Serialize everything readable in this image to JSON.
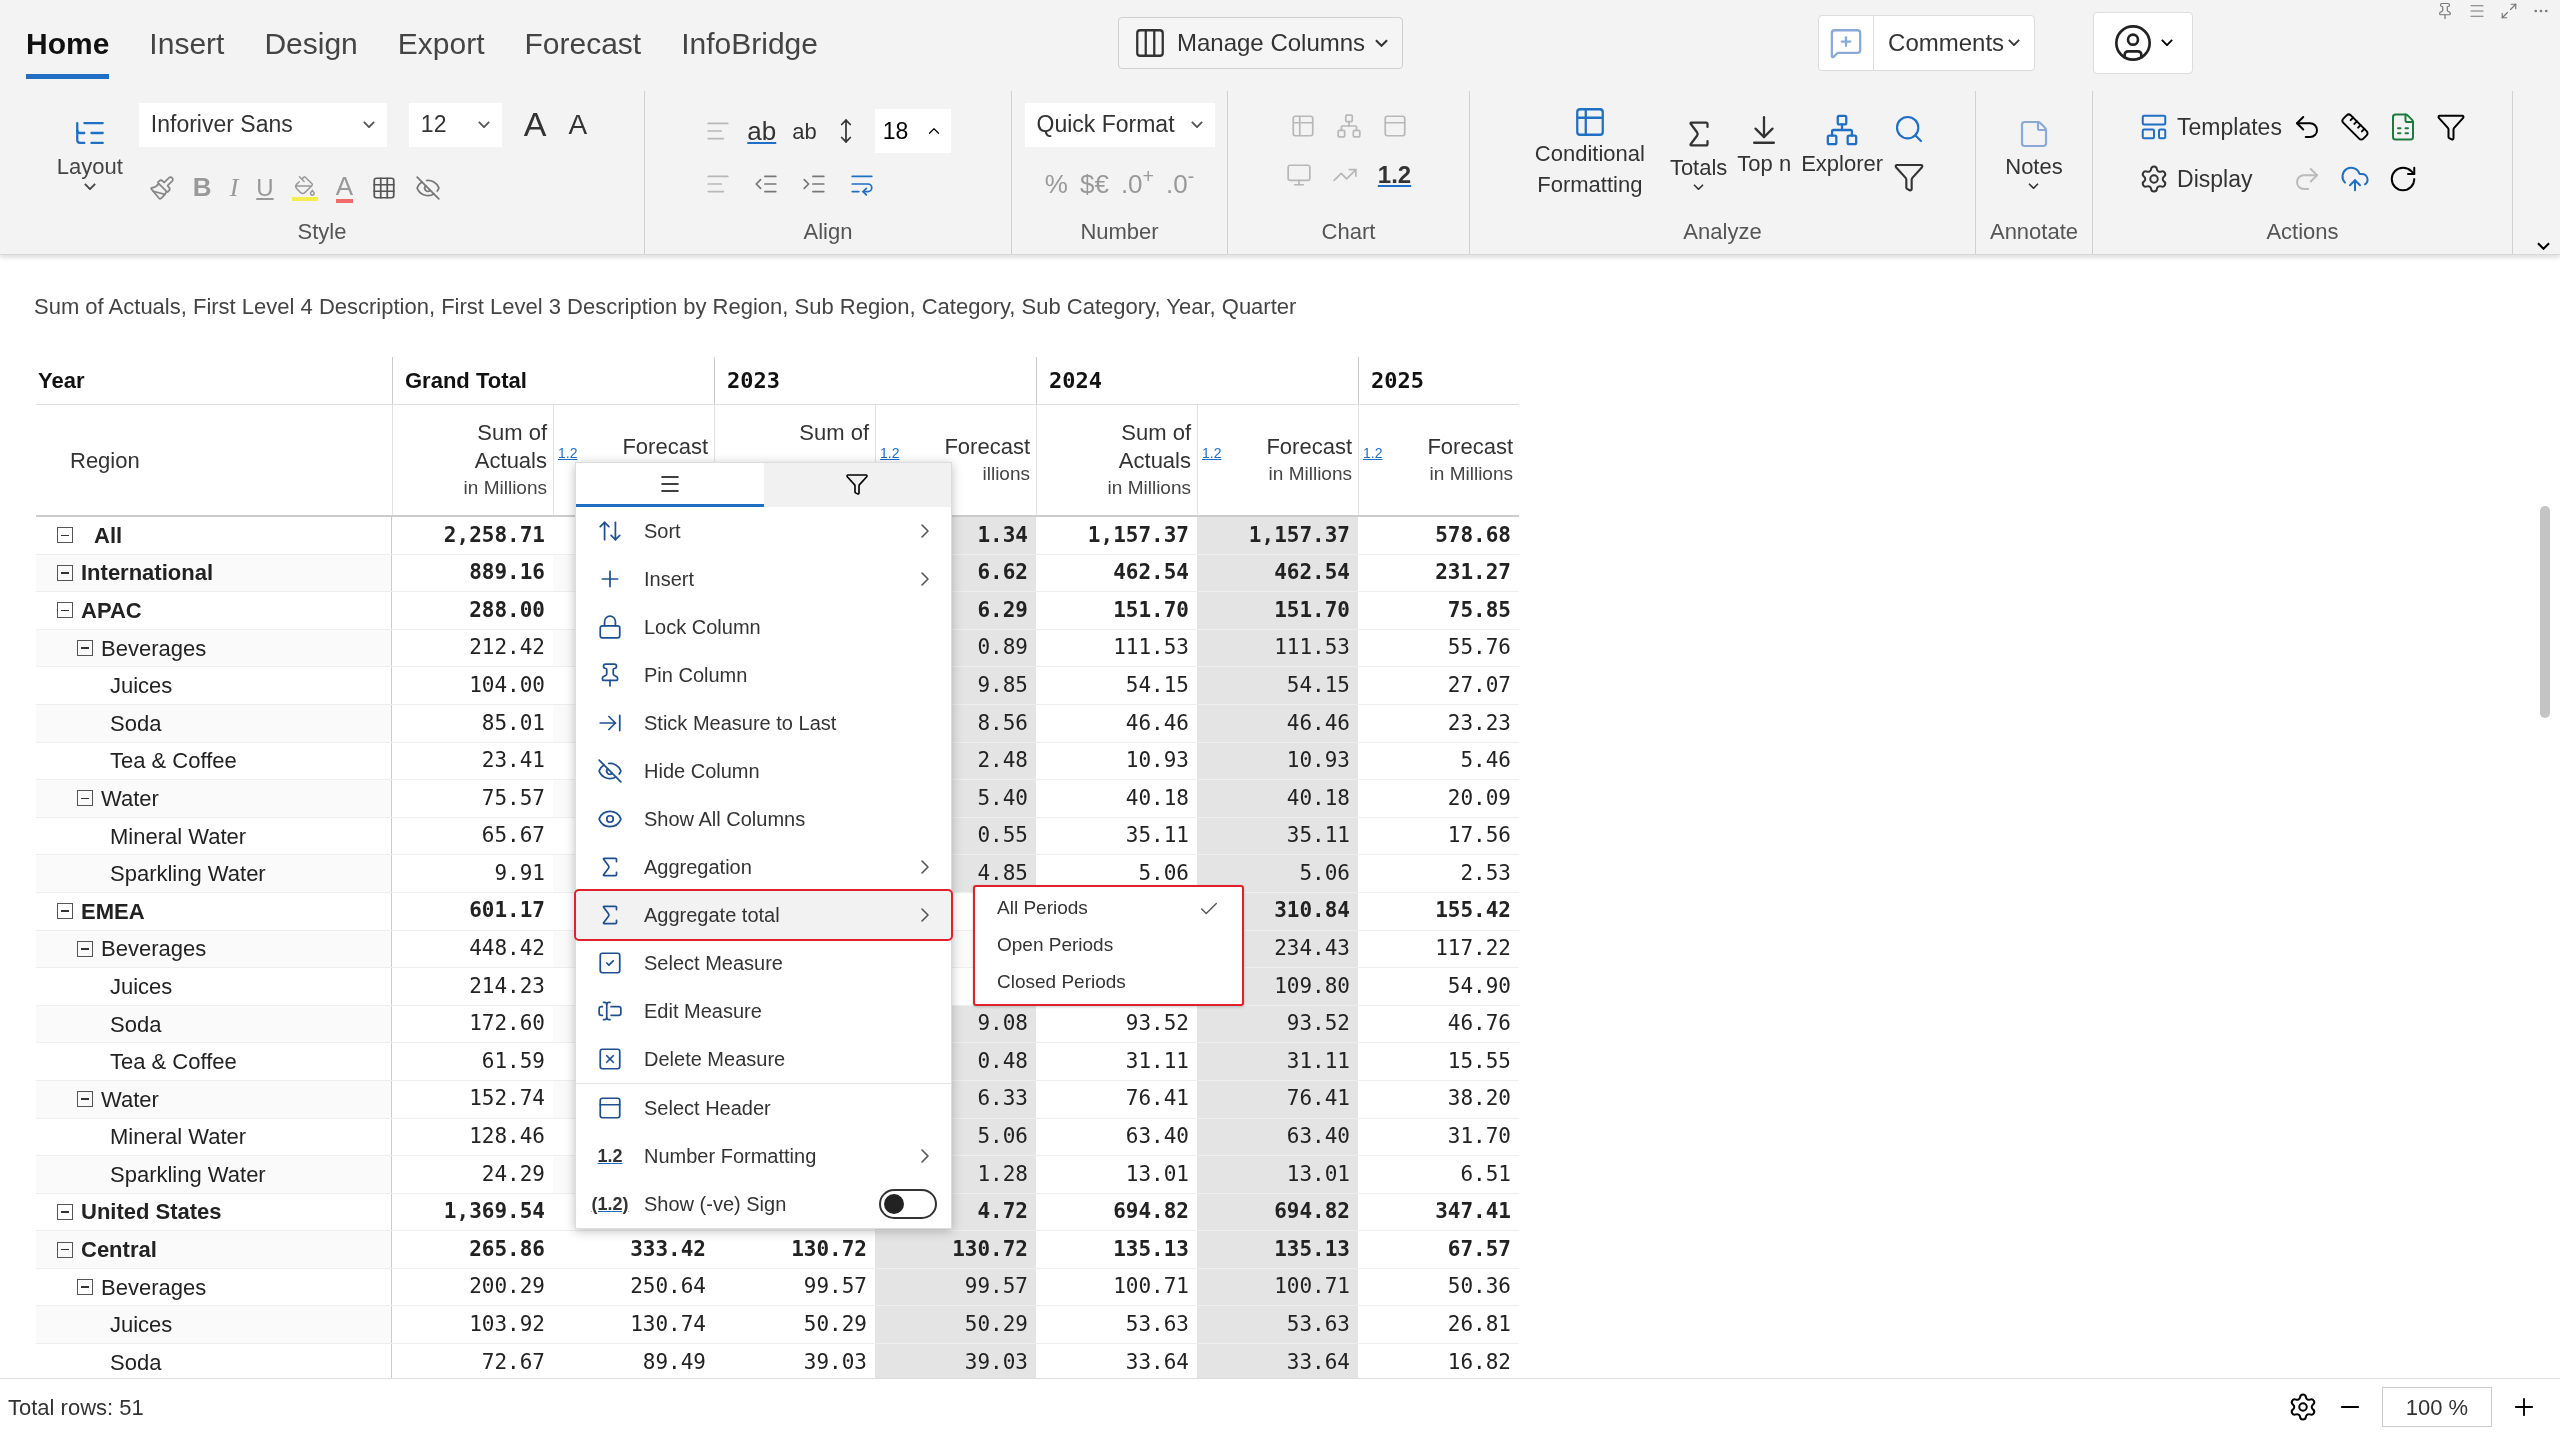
{
  "tabs": [
    {
      "label": "Home",
      "selected": true
    },
    {
      "label": "Insert",
      "selected": false
    },
    {
      "label": "Design",
      "selected": false
    },
    {
      "label": "Export",
      "selected": false
    },
    {
      "label": "Forecast",
      "selected": false
    },
    {
      "label": "InfoBridge",
      "selected": false
    }
  ],
  "manage_columns": {
    "label": "Manage Columns"
  },
  "comments": {
    "label": "Comments"
  },
  "ribbon": {
    "layout": "Layout",
    "font": "Inforiver Sans",
    "size": "12",
    "grow_glyphs": [
      "A",
      "A"
    ],
    "text_styles": [
      "B",
      "I",
      "U"
    ],
    "font_color_glyph": "A",
    "wrap_glyphs": [
      "ab",
      "ab"
    ],
    "line_spacing": "18",
    "quick_format": "Quick Format",
    "number_buttons": [
      "%",
      "$€",
      ".0$^{+}$",
      ".0$^{-}$"
    ],
    "chart_format": "1.2",
    "analyze": [
      "Conditional Formatting",
      "Totals",
      "Top n",
      "Explorer"
    ],
    "notes": "Notes",
    "actions": [
      "Templates",
      "Display"
    ],
    "groups": [
      "Style",
      "Align",
      "Number",
      "Chart",
      "Analyze",
      "Annotate",
      "Actions"
    ]
  },
  "subtitle": "Sum of Actuals, First Level 4 Description, First Level 3 Description by Region, Sub Region, Category, Sub Category, Year, Quarter",
  "table": {
    "row_header_top": "Year",
    "row_header": "Region",
    "groups": [
      {
        "label": "Grand Total",
        "measures": [
          {
            "kind": "actuals",
            "title_lines": [
              "Sum of",
              "Actuals"
            ],
            "unit": "in Millions",
            "shaded": false
          },
          {
            "kind": "forecast",
            "title_lines": [
              "Forecast"
            ],
            "format_glyph": "1.2",
            "shaded": false
          }
        ]
      },
      {
        "label": "2023",
        "measures": [
          {
            "kind": "actuals",
            "title_lines": [
              "Sum of"
            ],
            "shaded": false
          },
          {
            "kind": "forecast",
            "title_lines": [
              "Forecast"
            ],
            "unit": "illions",
            "format_glyph": "1.2",
            "shaded": true
          }
        ]
      },
      {
        "label": "2024",
        "measures": [
          {
            "kind": "actuals",
            "title_lines": [
              "Sum of",
              "Actuals"
            ],
            "unit": "in Millions",
            "shaded": false
          },
          {
            "kind": "forecast",
            "title_lines": [
              "Forecast"
            ],
            "unit": "in Millions",
            "format_glyph": "1.2",
            "shaded": true
          }
        ]
      },
      {
        "label": "2025",
        "measures": [
          {
            "kind": "forecast",
            "title_lines": [
              "Forecast"
            ],
            "unit": "in Millions",
            "format_glyph": "1.2",
            "shaded": false
          }
        ]
      }
    ],
    "rows": [
      {
        "label": "All",
        "expanded": true,
        "gt_actuals": "2,258.71",
        "y2023_forecast": "1.34",
        "y2024_actuals": "1,157.37",
        "y2024_forecast": "1,157.37",
        "y2025_forecast": "578.68"
      },
      {
        "label": "International",
        "expanded": true,
        "gt_actuals": "889.16",
        "y2023_forecast": "6.62",
        "y2024_actuals": "462.54",
        "y2024_forecast": "462.54",
        "y2025_forecast": "231.27",
        "children": [
          {
            "label": "APAC",
            "expanded": true,
            "gt_actuals": "288.00",
            "y2023_forecast": "6.29",
            "y2024_actuals": "151.70",
            "y2024_forecast": "151.70",
            "y2025_forecast": "75.85",
            "children": [
              {
                "label": "Beverages",
                "expanded": true,
                "gt_actuals": "212.42",
                "y2023_forecast": "0.89",
                "y2024_actuals": "111.53",
                "y2024_forecast": "111.53",
                "y2025_forecast": "55.76",
                "children": [
                  {
                    "label": "Juices",
                    "gt_actuals": "104.00",
                    "y2023_forecast": "9.85",
                    "y2024_actuals": "54.15",
                    "y2024_forecast": "54.15",
                    "y2025_forecast": "27.07"
                  },
                  {
                    "label": "Soda",
                    "gt_actuals": "85.01",
                    "y2023_forecast": "8.56",
                    "y2024_actuals": "46.46",
                    "y2024_forecast": "46.46",
                    "y2025_forecast": "23.23"
                  },
                  {
                    "label": "Tea & Coffee",
                    "gt_actuals": "23.41",
                    "y2023_forecast": "2.48",
                    "y2024_actuals": "10.93",
                    "y2024_forecast": "10.93",
                    "y2025_forecast": "5.46"
                  }
                ]
              },
              {
                "label": "Water",
                "expanded": true,
                "gt_actuals": "75.57",
                "y2023_forecast": "5.40",
                "y2024_actuals": "40.18",
                "y2024_forecast": "40.18",
                "y2025_forecast": "20.09",
                "children": [
                  {
                    "label": "Mineral Water",
                    "gt_actuals": "65.67",
                    "y2023_forecast": "0.55",
                    "y2024_actuals": "35.11",
                    "y2024_forecast": "35.11",
                    "y2025_forecast": "17.56"
                  },
                  {
                    "label": "Sparkling Water",
                    "gt_actuals": "9.91",
                    "y2023_forecast": "4.85",
                    "y2024_actuals": "5.06",
                    "y2024_forecast": "5.06",
                    "y2025_forecast": "2.53"
                  }
                ]
              }
            ]
          },
          {
            "label": "EMEA",
            "expanded": true,
            "gt_actuals": "601.17",
            "y2024_forecast": "310.84",
            "y2025_forecast": "155.42",
            "children": [
              {
                "label": "Beverages",
                "expanded": true,
                "gt_actuals": "448.42",
                "y2024_forecast": "234.43",
                "y2025_forecast": "117.22",
                "children": [
                  {
                    "label": "Juices",
                    "gt_actuals": "214.23",
                    "y2024_forecast": "109.80",
                    "y2025_forecast": "54.90"
                  },
                  {
                    "label": "Soda",
                    "gt_actuals": "172.60",
                    "y2023_forecast": "9.08",
                    "y2024_actuals": "93.52",
                    "y2024_forecast": "93.52",
                    "y2025_forecast": "46.76"
                  },
                  {
                    "label": "Tea & Coffee",
                    "gt_actuals": "61.59",
                    "y2023_forecast": "0.48",
                    "y2024_actuals": "31.11",
                    "y2024_forecast": "31.11",
                    "y2025_forecast": "15.55"
                  }
                ]
              },
              {
                "label": "Water",
                "expanded": true,
                "gt_actuals": "152.74",
                "y2023_forecast": "6.33",
                "y2024_actuals": "76.41",
                "y2024_forecast": "76.41",
                "y2025_forecast": "38.20",
                "children": [
                  {
                    "label": "Mineral Water",
                    "gt_actuals": "128.46",
                    "y2023_forecast": "5.06",
                    "y2024_actuals": "63.40",
                    "y2024_forecast": "63.40",
                    "y2025_forecast": "31.70"
                  },
                  {
                    "label": "Sparkling Water",
                    "gt_actuals": "24.29",
                    "y2023_forecast": "1.28",
                    "y2024_actuals": "13.01",
                    "y2024_forecast": "13.01",
                    "y2025_forecast": "6.51"
                  }
                ]
              }
            ]
          }
        ]
      },
      {
        "label": "United States",
        "expanded": true,
        "gt_actuals": "1,369.54",
        "y2023_forecast": "4.72",
        "y2024_actuals": "694.82",
        "y2024_forecast": "694.82",
        "y2025_forecast": "347.41",
        "children": [
          {
            "label": "Central",
            "expanded": true,
            "gt_actuals": "265.86",
            "gt_forecast": "333.42",
            "y2023_actuals": "130.72",
            "y2023_forecast": "130.72",
            "y2024_actuals": "135.13",
            "y2024_forecast": "135.13",
            "y2025_forecast": "67.57",
            "children": [
              {
                "label": "Beverages",
                "expanded": true,
                "gt_actuals": "200.29",
                "gt_forecast": "250.64",
                "y2023_actuals": "99.57",
                "y2023_forecast": "99.57",
                "y2024_actuals": "100.71",
                "y2024_forecast": "100.71",
                "y2025_forecast": "50.36",
                "children": [
                  {
                    "label": "Juices",
                    "gt_actuals": "103.92",
                    "gt_forecast": "130.74",
                    "y2023_actuals": "50.29",
                    "y2023_forecast": "50.29",
                    "y2024_actuals": "53.63",
                    "y2024_forecast": "53.63",
                    "y2025_forecast": "26.81"
                  },
                  {
                    "label": "Soda",
                    "gt_actuals": "72.67",
                    "gt_forecast": "89.49",
                    "y2023_actuals": "39.03",
                    "y2023_forecast": "39.03",
                    "y2024_actuals": "33.64",
                    "y2024_forecast": "33.64",
                    "y2025_forecast": "16.82"
                  }
                ]
              }
            ]
          }
        ]
      }
    ]
  },
  "context_menu": {
    "tabs": [
      {
        "kind": "options",
        "selected": true
      },
      {
        "kind": "filter",
        "selected": false
      }
    ],
    "sections": [
      [
        {
          "label": "Sort",
          "kind": "action",
          "submenu": true,
          "highlighted": false
        },
        {
          "label": "Insert",
          "kind": "action",
          "submenu": true,
          "highlighted": false
        },
        {
          "label": "Lock Column",
          "kind": "action",
          "submenu": false,
          "highlighted": false
        },
        {
          "label": "Pin Column",
          "kind": "action",
          "submenu": false,
          "highlighted": false
        },
        {
          "label": "Stick Measure to Last",
          "kind": "action",
          "submenu": false,
          "highlighted": false
        },
        {
          "label": "Hide Column",
          "kind": "action",
          "submenu": false,
          "highlighted": false
        },
        {
          "label": "Show All Columns",
          "kind": "action",
          "submenu": false,
          "highlighted": false
        },
        {
          "label": "Aggregation",
          "kind": "action",
          "submenu": true,
          "highlighted": false
        },
        {
          "label": "Aggregate total",
          "kind": "action",
          "submenu": true,
          "highlighted": true
        },
        {
          "label": "Select Measure",
          "kind": "action",
          "submenu": false,
          "highlighted": false
        },
        {
          "label": "Edit Measure",
          "kind": "action",
          "submenu": false,
          "highlighted": false
        },
        {
          "label": "Delete Measure",
          "kind": "action",
          "submenu": false,
          "highlighted": false
        }
      ],
      [
        {
          "label": "Select Header",
          "kind": "action",
          "submenu": false,
          "highlighted": false
        },
        {
          "label": "Number Formatting",
          "glyph": "1.2",
          "kind": "action",
          "submenu": true,
          "highlighted": false
        },
        {
          "label": "Show (-ve) Sign",
          "glyph": "(1.2)",
          "kind": "toggle",
          "on": false,
          "submenu": false,
          "highlighted": false
        }
      ]
    ]
  },
  "submenu": {
    "highlighted": true,
    "items": [
      {
        "label": "All Periods",
        "checked": true
      },
      {
        "label": "Open Periods",
        "checked": false
      },
      {
        "label": "Closed Periods",
        "checked": false
      }
    ]
  },
  "status_bar": {
    "total_rows": "Total rows: 51",
    "zoom": "100 %"
  }
}
